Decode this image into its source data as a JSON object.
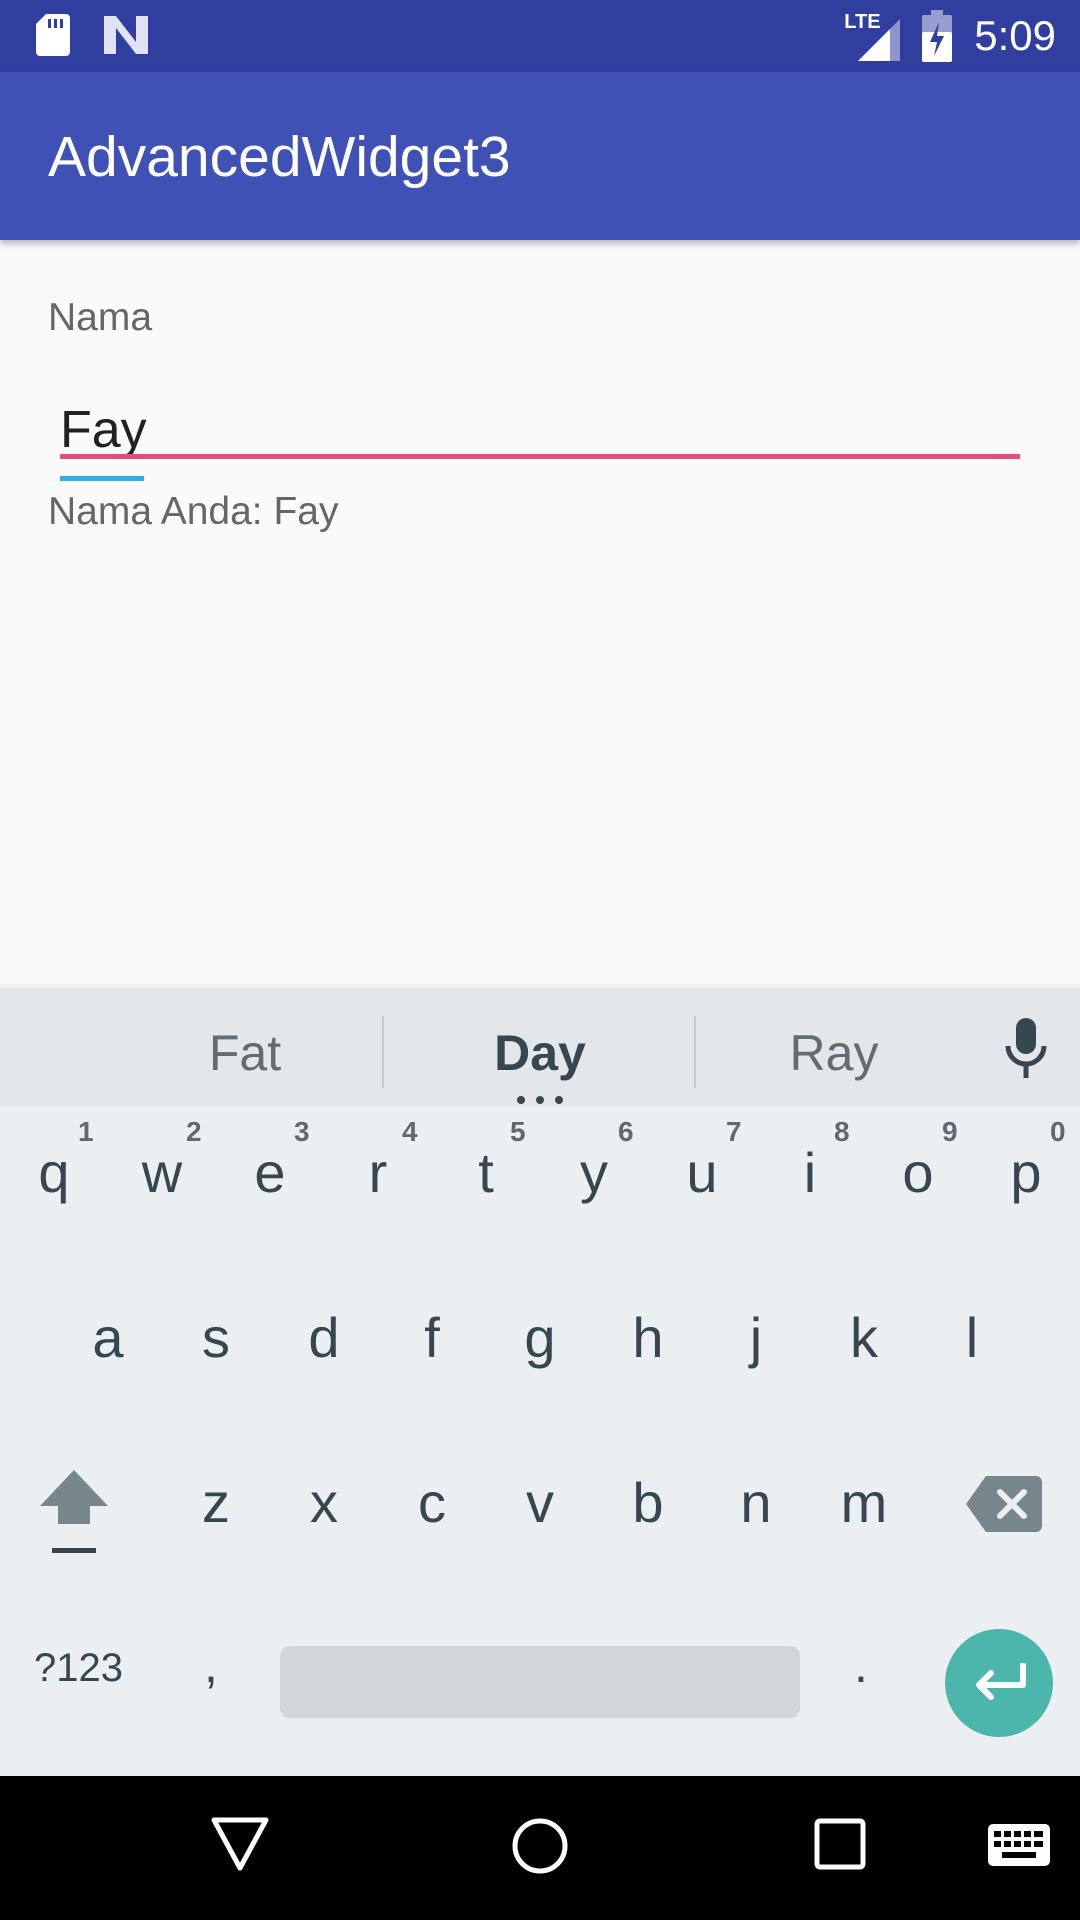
{
  "status_bar": {
    "time": "5:09",
    "network": "LTE",
    "icons": [
      "sd-card-icon",
      "n-logo-icon",
      "signal-icon",
      "battery-charging-icon"
    ]
  },
  "app_bar": {
    "title": "AdvancedWidget3"
  },
  "form": {
    "label": "Nama",
    "input_value": "Fay",
    "output_text": "Nama Anda: Fay"
  },
  "keyboard": {
    "suggestions": [
      "Fat",
      "Day",
      "Ray"
    ],
    "row1": [
      "q",
      "w",
      "e",
      "r",
      "t",
      "y",
      "u",
      "i",
      "o",
      "p"
    ],
    "row1_hints": [
      "1",
      "2",
      "3",
      "4",
      "5",
      "6",
      "7",
      "8",
      "9",
      "0"
    ],
    "row2": [
      "a",
      "s",
      "d",
      "f",
      "g",
      "h",
      "j",
      "k",
      "l"
    ],
    "row3": [
      "z",
      "x",
      "c",
      "v",
      "b",
      "n",
      "m"
    ],
    "symbols_key": "?123",
    "comma": ",",
    "period": ".",
    "accent_color": "#4db6ac"
  },
  "colors": {
    "primary": "#3f51b5",
    "primary_dark": "#303f9f",
    "accent": "#e84a82"
  }
}
